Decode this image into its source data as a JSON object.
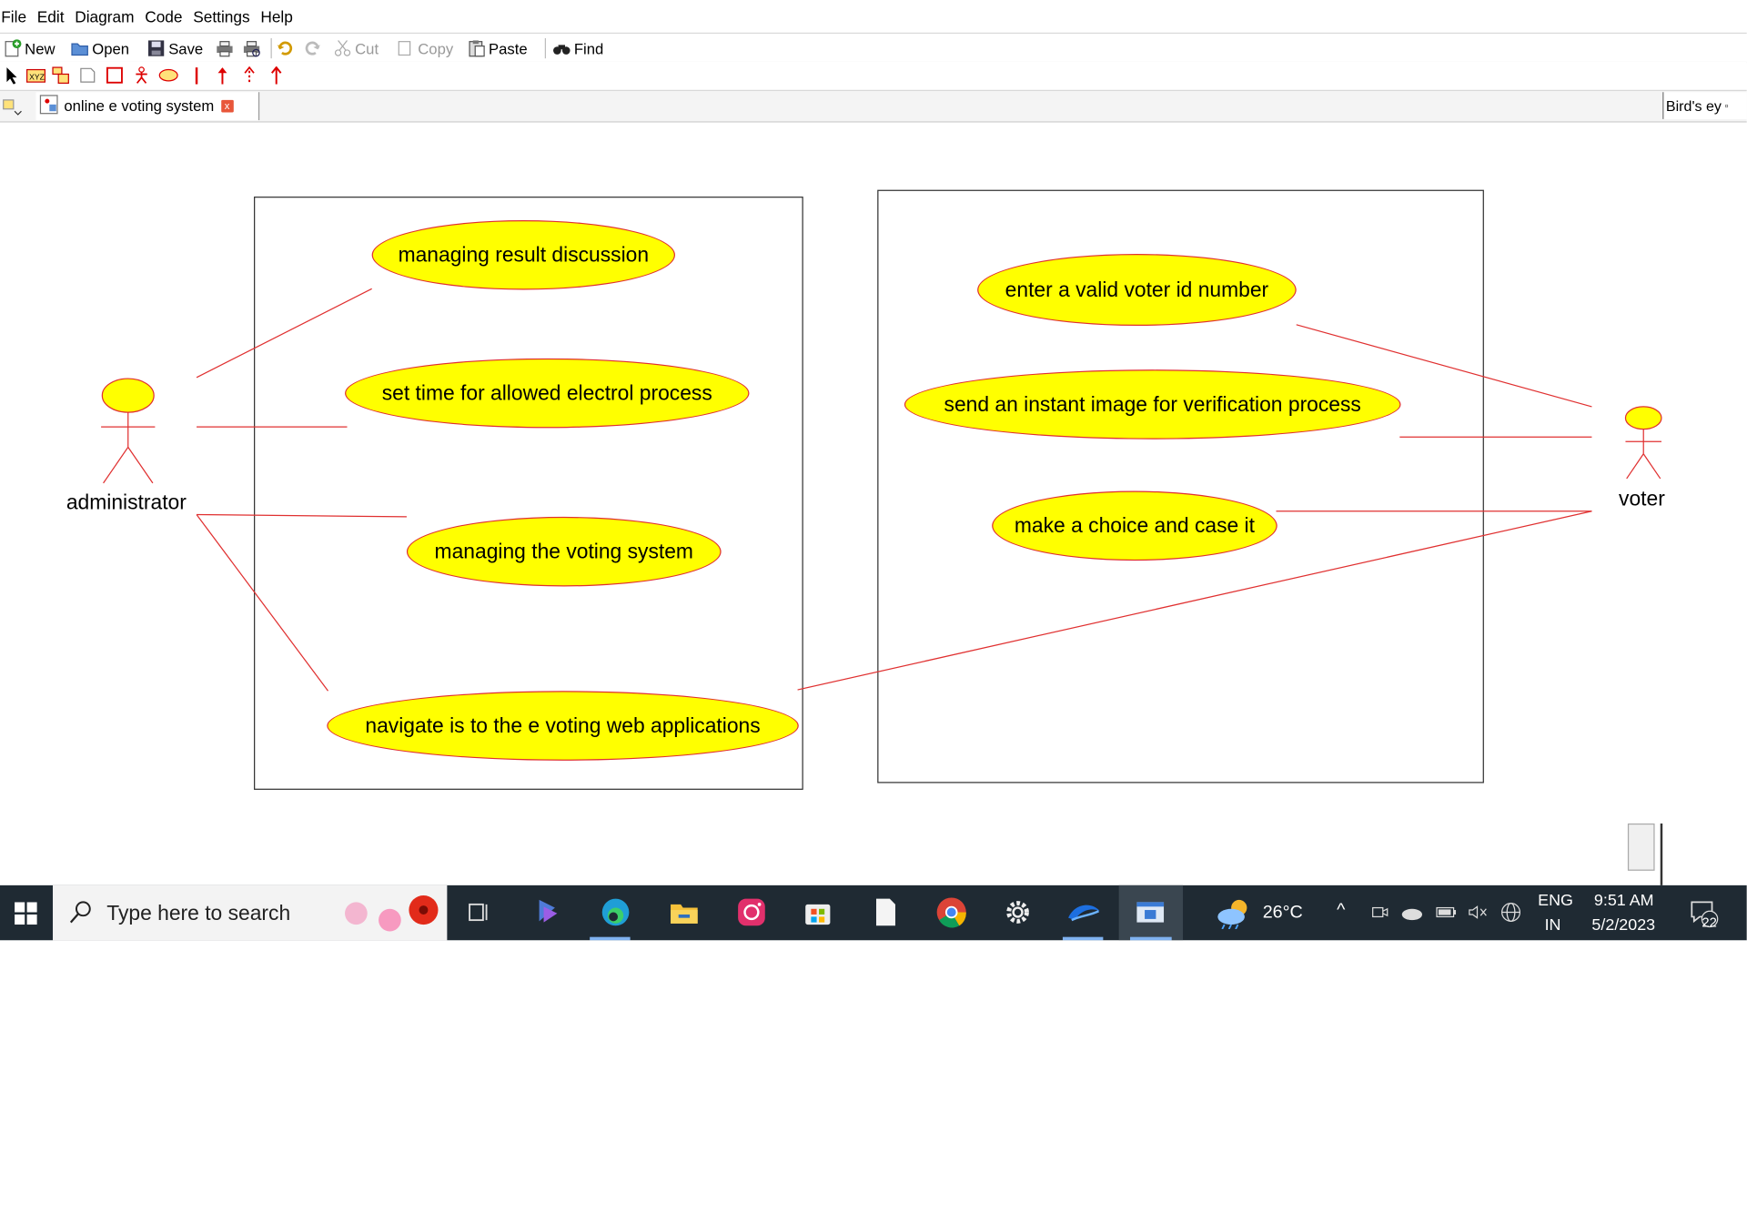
{
  "menu": [
    "File",
    "Edit",
    "Diagram",
    "Code",
    "Settings",
    "Help"
  ],
  "toolbar": {
    "new": "New",
    "open": "Open",
    "save": "Save",
    "cut": "Cut",
    "copy": "Copy",
    "paste": "Paste",
    "find": "Find"
  },
  "tools": {
    "xyz": "XYZ"
  },
  "tab": {
    "title": "online e voting system",
    "close": "x"
  },
  "birds_eye": "Bird's ey",
  "diagram": {
    "actors": {
      "administrator": "administrator",
      "voter": "voter"
    },
    "use_cases": [
      "managing result discussion",
      "set time for allowed electrol process",
      "managing the voting system",
      "navigate is to the e voting web applications",
      "enter a valid voter id number",
      "send an instant image for verification process",
      "make a choice and case it"
    ]
  },
  "colors": {
    "usecase_fill": "#ffff00",
    "line_red": "#e03030",
    "taskbar": "#1f2a33"
  },
  "taskbar": {
    "search_placeholder": "Type here to search",
    "weather": "26°C",
    "lang": "ENG",
    "region": "IN",
    "time": "9:51 AM",
    "date": "5/2/2023",
    "notifications": "22"
  }
}
